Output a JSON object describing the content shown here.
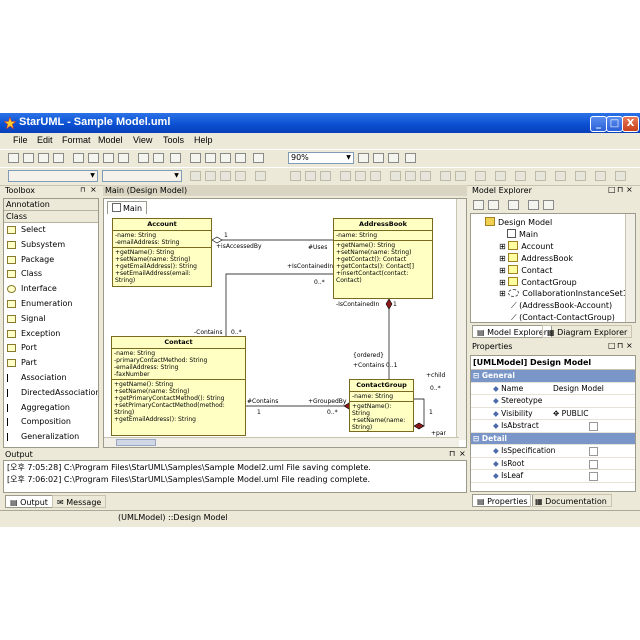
{
  "window": {
    "title": "StarUML - Sample Model.uml",
    "btn_min": "_",
    "btn_max": "□",
    "btn_close": "X"
  },
  "menu": [
    "File",
    "Edit",
    "Format",
    "Model",
    "View",
    "Tools",
    "Help"
  ],
  "toolbar": {
    "zoom": "90%"
  },
  "toolbox": {
    "title": "Toolbox",
    "sections": [
      "Annotation",
      "Class"
    ],
    "items": [
      "Select",
      "Subsystem",
      "Package",
      "Class",
      "Interface",
      "Enumeration",
      "Signal",
      "Exception",
      "Port",
      "Part",
      "Association",
      "DirectedAssociation",
      "Aggregation",
      "Composition",
      "Generalization"
    ]
  },
  "diagram": {
    "panel_title": "Main (Design Model)",
    "tab": "Main",
    "classes": {
      "account": {
        "name": "Account",
        "attrs": [
          "-name: String",
          "-emailAddress: String"
        ],
        "ops": [
          "+getName(): String",
          "+setName(name: String)",
          "+getEmailAddress(): String",
          "+setEmailAddress(email: String)"
        ]
      },
      "addressbook": {
        "name": "AddressBook",
        "attrs": [
          "-name: String"
        ],
        "ops": [
          "+getName(): String",
          "+setName(name: String)",
          "+getContact(): Contact",
          "+getContacts(): Contact[]",
          "+insertContact(contact: Contact)"
        ]
      },
      "contact": {
        "name": "Contact",
        "attrs": [
          "-name: String",
          "-primaryContactMethod: String",
          "-emailAddress: String",
          "-faxNumber"
        ],
        "ops": [
          "+getName(): String",
          "+setName(name: String)",
          "+getPrimaryContactMethod(): String",
          "+setPrimaryContactMethod(method: String)",
          "+getEmailAddress(): String"
        ]
      },
      "contactgroup": {
        "name": "ContactGroup",
        "attrs": [
          "-name: String"
        ],
        "ops": [
          "+getName(): String",
          "+setName(name: String)"
        ]
      }
    },
    "labels": {
      "one_a": "1",
      "is_accessed_by": "+isAccessedBy",
      "uses": "#Uses",
      "is_contained_in": "+IsContainedIn",
      "zero_many_a": "0..*",
      "is_contained_in2": "-IsContainedIn",
      "one_b": "1",
      "contains_a": "-Contains",
      "zero_many_b": "0..*",
      "ordered": "{ordered}",
      "contains_b": "+Contains",
      "zero_one": "0..1",
      "child": "+child",
      "zero_many_c": "0..*",
      "one_c": "1",
      "contains_c": "#Contains",
      "one_d": "1",
      "grouped_by": "+GroupedBy",
      "zero_many_d": "0..*",
      "par": "+par"
    }
  },
  "explorer": {
    "title": "Model Explorer",
    "items": [
      "Design Model",
      "Main",
      "Account",
      "AddressBook",
      "Contact",
      "ContactGroup",
      "CollaborationInstanceSet1",
      "(AddressBook-Account)",
      "(Contact-ContactGroup)"
    ],
    "tabs": [
      "Model Explorer",
      "Diagram Explorer"
    ]
  },
  "properties": {
    "title": "Properties",
    "header": "[UMLModel] Design Model",
    "sections": [
      "General",
      "Detail"
    ],
    "rows": [
      {
        "name": "Name",
        "value": "Design Model"
      },
      {
        "name": "Stereotype",
        "value": ""
      },
      {
        "name": "Visibility",
        "value": "PUBLIC"
      },
      {
        "name": "IsAbstract",
        "value": ""
      }
    ],
    "detail_rows": [
      {
        "name": "IsSpecification",
        "value": ""
      },
      {
        "name": "IsRoot",
        "value": ""
      },
      {
        "name": "IsLeaf",
        "value": ""
      }
    ],
    "tabs": [
      "Properties",
      "Documentation"
    ]
  },
  "output": {
    "title": "Output",
    "lines": [
      "[오후 7:05:28] C:\\Program Files\\StarUML\\Samples\\Sample Model2.uml File saving complete.",
      "[오후 7:06:02] C:\\Program Files\\StarUML\\Samples\\Sample Model.uml File reading complete."
    ],
    "tabs": [
      "Output",
      "Message"
    ]
  },
  "status": {
    "text": "(UMLModel) ::Design Model"
  }
}
